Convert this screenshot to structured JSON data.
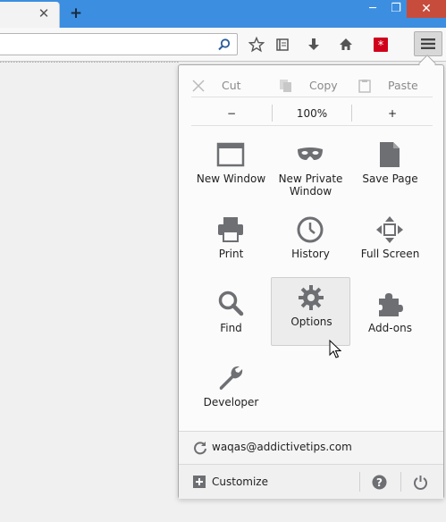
{
  "window": {
    "tab_close": "✕",
    "new_tab": "+",
    "minimize": "─",
    "maximize": "❐",
    "close": "✕"
  },
  "toolbar": {
    "url_value": "",
    "url_placeholder": ""
  },
  "menu_panel": {
    "edit": {
      "cut_label": "Cut",
      "copy_label": "Copy",
      "paste_label": "Paste"
    },
    "zoom": {
      "out_label": "−",
      "level": "100%",
      "in_label": "+"
    },
    "tiles": [
      {
        "label": "New Window",
        "icon": "new-window-icon"
      },
      {
        "label": "New Private Window",
        "icon": "mask-icon"
      },
      {
        "label": "Save Page",
        "icon": "page-icon"
      },
      {
        "label": "Print",
        "icon": "printer-icon"
      },
      {
        "label": "History",
        "icon": "clock-icon"
      },
      {
        "label": "Full Screen",
        "icon": "fullscreen-icon"
      },
      {
        "label": "Find",
        "icon": "magnifier-icon"
      },
      {
        "label": "Options",
        "icon": "gear-icon"
      },
      {
        "label": "Add-ons",
        "icon": "puzzle-icon"
      },
      {
        "label": "Developer",
        "icon": "wrench-icon"
      }
    ],
    "sync_account": "waqas@addictivetips.com",
    "customize_label": "Customize"
  },
  "colors": {
    "titlebar": "#3c8ee0",
    "close_button": "#c74c3c",
    "icon_gray": "#6d6f73",
    "lastpass_red": "#d0021b"
  }
}
